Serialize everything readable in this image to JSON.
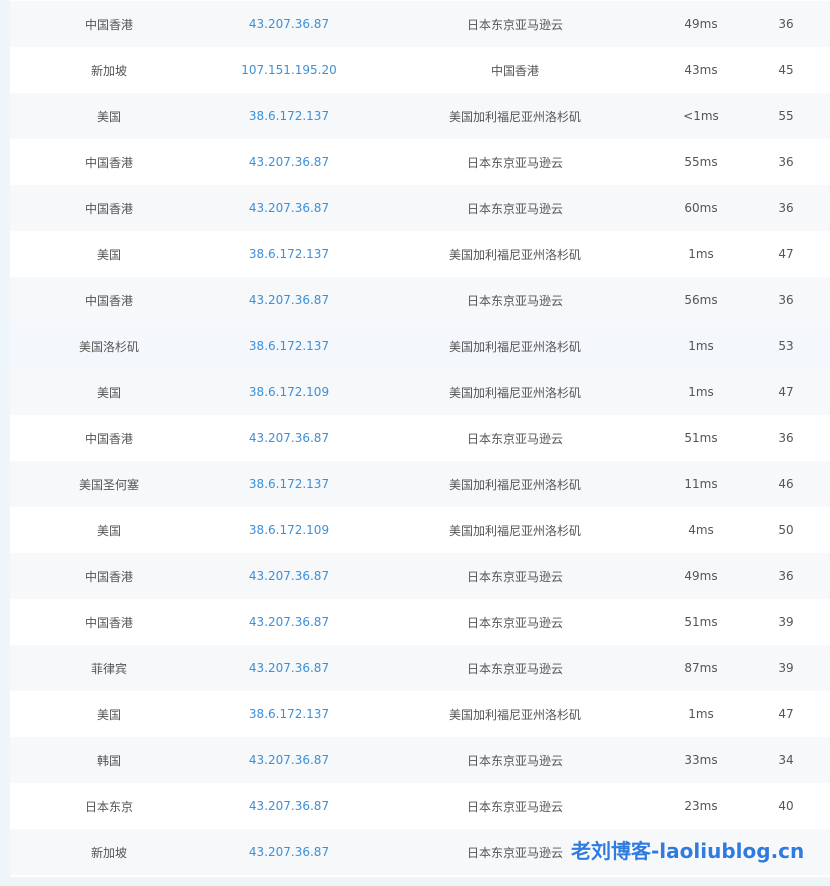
{
  "rows": [
    {
      "location": "中国香港",
      "ip": "43.207.36.87",
      "asn": "日本东京亚马逊云",
      "latency": "49ms",
      "hops": "36"
    },
    {
      "location": "新加坡",
      "ip": "107.151.195.20",
      "asn": "中国香港",
      "latency": "43ms",
      "hops": "45"
    },
    {
      "location": "美国",
      "ip": "38.6.172.137",
      "asn": "美国加利福尼亚州洛杉矶",
      "latency": "<1ms",
      "hops": "55"
    },
    {
      "location": "中国香港",
      "ip": "43.207.36.87",
      "asn": "日本东京亚马逊云",
      "latency": "55ms",
      "hops": "36"
    },
    {
      "location": "中国香港",
      "ip": "43.207.36.87",
      "asn": "日本东京亚马逊云",
      "latency": "60ms",
      "hops": "36"
    },
    {
      "location": "美国",
      "ip": "38.6.172.137",
      "asn": "美国加利福尼亚州洛杉矶",
      "latency": "1ms",
      "hops": "47"
    },
    {
      "location": "中国香港",
      "ip": "43.207.36.87",
      "asn": "日本东京亚马逊云",
      "latency": "56ms",
      "hops": "36"
    },
    {
      "location": "美国洛杉矶",
      "ip": "38.6.172.137",
      "asn": "美国加利福尼亚州洛杉矶",
      "latency": "1ms",
      "hops": "53"
    },
    {
      "location": "美国",
      "ip": "38.6.172.109",
      "asn": "美国加利福尼亚州洛杉矶",
      "latency": "1ms",
      "hops": "47"
    },
    {
      "location": "中国香港",
      "ip": "43.207.36.87",
      "asn": "日本东京亚马逊云",
      "latency": "51ms",
      "hops": "36"
    },
    {
      "location": "美国圣何塞",
      "ip": "38.6.172.137",
      "asn": "美国加利福尼亚州洛杉矶",
      "latency": "11ms",
      "hops": "46"
    },
    {
      "location": "美国",
      "ip": "38.6.172.109",
      "asn": "美国加利福尼亚州洛杉矶",
      "latency": "4ms",
      "hops": "50"
    },
    {
      "location": "中国香港",
      "ip": "43.207.36.87",
      "asn": "日本东京亚马逊云",
      "latency": "49ms",
      "hops": "36"
    },
    {
      "location": "中国香港",
      "ip": "43.207.36.87",
      "asn": "日本东京亚马逊云",
      "latency": "51ms",
      "hops": "39"
    },
    {
      "location": "菲律宾",
      "ip": "43.207.36.87",
      "asn": "日本东京亚马逊云",
      "latency": "87ms",
      "hops": "39"
    },
    {
      "location": "美国",
      "ip": "38.6.172.137",
      "asn": "美国加利福尼亚州洛杉矶",
      "latency": "1ms",
      "hops": "47"
    },
    {
      "location": "韩国",
      "ip": "43.207.36.87",
      "asn": "日本东京亚马逊云",
      "latency": "33ms",
      "hops": "34"
    },
    {
      "location": "日本东京",
      "ip": "43.207.36.87",
      "asn": "日本东京亚马逊云",
      "latency": "23ms",
      "hops": "40"
    },
    {
      "location": "新加坡",
      "ip": "43.207.36.87",
      "asn": "日本东京亚马逊云",
      "latency": "",
      "hops": ""
    }
  ],
  "watermark": "老刘博客-laoliublog.cn",
  "colors": {
    "ip_link": "#3d8fd9",
    "row_stripe": "#f7f8fa",
    "watermark": "#2f7be0"
  }
}
